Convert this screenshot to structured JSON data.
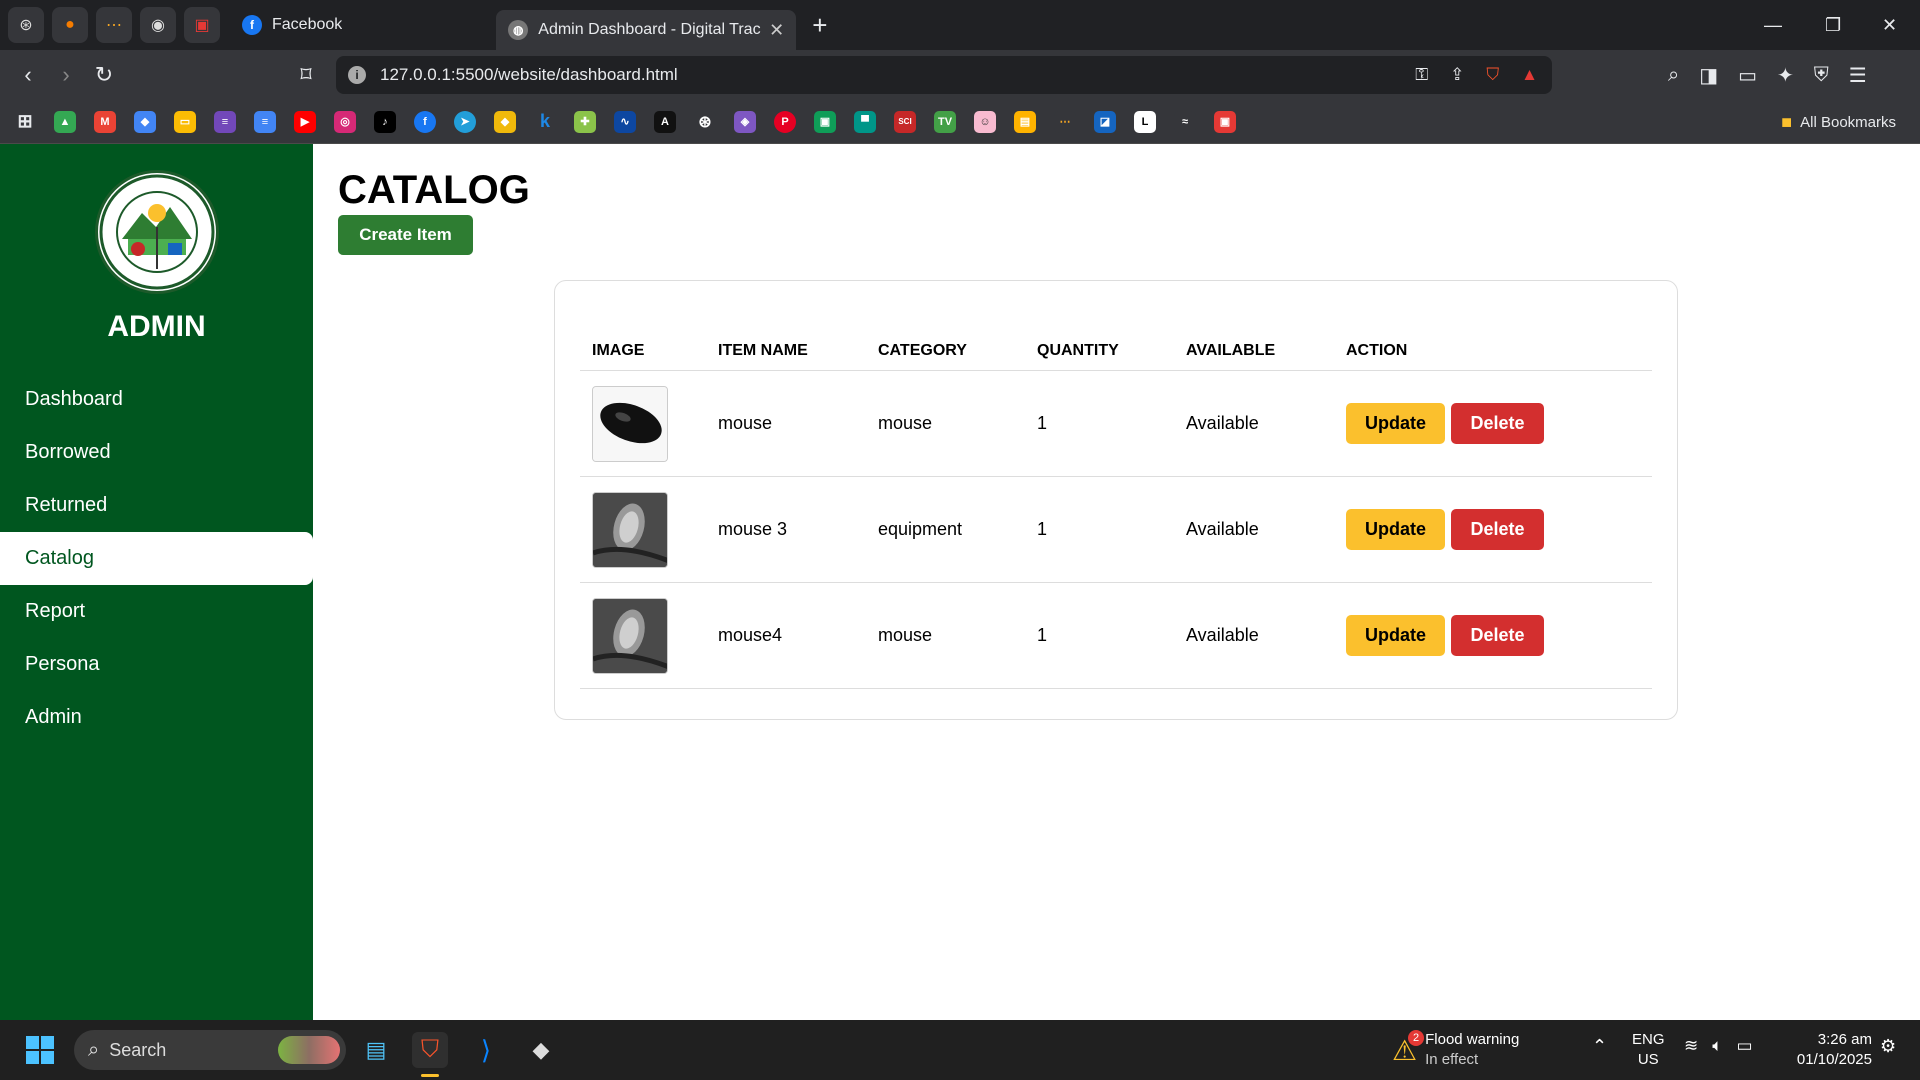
{
  "browser": {
    "tabs": [
      {
        "title": "Facebook"
      },
      {
        "title": "Admin Dashboard - Digital Track"
      }
    ],
    "url": "127.0.0.1:5500/website/dashboard.html",
    "all_bookmarks_label": "All Bookmarks"
  },
  "sidebar": {
    "title": "ADMIN",
    "logo_icon": "university-seal-logo",
    "items": [
      {
        "label": "Dashboard"
      },
      {
        "label": "Borrowed"
      },
      {
        "label": "Returned"
      },
      {
        "label": "Catalog",
        "active": true
      },
      {
        "label": "Report"
      },
      {
        "label": "Persona"
      },
      {
        "label": "Admin"
      }
    ]
  },
  "main": {
    "title": "CATALOG",
    "create_label": "Create Item",
    "columns": [
      "IMAGE",
      "ITEM NAME",
      "CATEGORY",
      "QUANTITY",
      "AVAILABLE",
      "ACTION"
    ],
    "rows": [
      {
        "image_icon": "mouse-photo",
        "name": "mouse",
        "category": "mouse",
        "quantity": "1",
        "available": "Available",
        "update": "Update",
        "delete": "Delete"
      },
      {
        "image_icon": "mouse-photo-dark",
        "name": "mouse 3",
        "category": "equipment",
        "quantity": "1",
        "available": "Available",
        "update": "Update",
        "delete": "Delete"
      },
      {
        "image_icon": "mouse-photo-dark",
        "name": "mouse4",
        "category": "mouse",
        "quantity": "1",
        "available": "Available",
        "update": "Update",
        "delete": "Delete"
      }
    ]
  },
  "taskbar": {
    "search_placeholder": "Search",
    "weather_title": "Flood warning",
    "weather_sub": "In effect",
    "weather_badge": "2",
    "lang_1": "ENG",
    "lang_2": "US",
    "time": "3:26 am",
    "date": "01/10/2025"
  },
  "colors": {
    "sidebar": "#00561f",
    "create_button": "#2e7d32",
    "update_button": "#fbc02d",
    "delete_button": "#d32f2f"
  }
}
